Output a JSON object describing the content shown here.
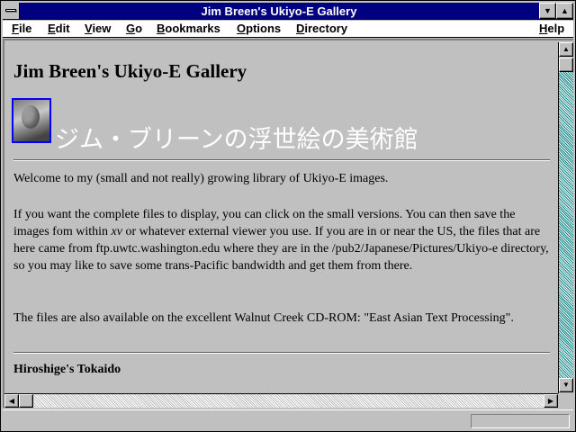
{
  "window": {
    "title": "Jim Breen's Ukiyo-E Gallery"
  },
  "menubar": {
    "file": {
      "mnemonic": "F",
      "rest": "ile"
    },
    "edit": {
      "mnemonic": "E",
      "rest": "dit"
    },
    "view": {
      "mnemonic": "V",
      "rest": "iew"
    },
    "go": {
      "mnemonic": "G",
      "rest": "o"
    },
    "bookmarks": {
      "mnemonic": "B",
      "rest": "ookmarks"
    },
    "options": {
      "mnemonic": "O",
      "rest": "ptions"
    },
    "directory": {
      "mnemonic": "D",
      "rest": "irectory"
    },
    "help": {
      "mnemonic": "H",
      "rest": "elp"
    }
  },
  "page": {
    "heading": "Jim Breen's Ukiyo-E Gallery",
    "japanese_title": "ジム・ブリーンの浮世絵の美術館",
    "intro": "Welcome to my (small and not really) growing library of Ukiyo-E images.",
    "para2_before": "If you want the complete files to display, you can click on the small versions. You can then save the images fom within ",
    "para2_xv": "xv",
    "para2_after": " or whatever external viewer you use. If you are in or near the US, the files that are here came from ftp.uwtc.washington.edu where they are in the /pub2/Japanese/Pictures/Ukiyo-e directory, so you may like to save some trans-Pacific bandwidth and get them from there.",
    "para3": "The files are also available on the excellent Walnut Creek CD-ROM: \"East Asian Text Processing\".",
    "section_heading": "Hiroshige's Tokaido"
  },
  "statusbar": {
    "text": ""
  },
  "colors": {
    "titlebar": "#000080",
    "background": "#c0c0c0",
    "scroll_track": "#008080",
    "avatar_border": "#0000ff"
  },
  "icons": [
    "system-menu-icon",
    "minimize-icon",
    "maximize-icon",
    "scroll-up-icon",
    "scroll-down-icon",
    "scroll-left-icon",
    "scroll-right-icon"
  ]
}
